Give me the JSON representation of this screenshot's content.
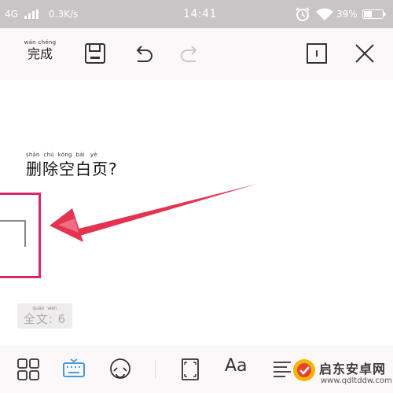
{
  "status_bar": {
    "network": "4G",
    "speed": "0.3K/s",
    "time": "14:41",
    "battery": "39%"
  },
  "toolbar": {
    "done_pinyin": "wán chéng",
    "done_label": "完成",
    "icons": [
      "save-icon",
      "undo-icon",
      "redo-icon",
      "cursor-box-icon",
      "close-icon"
    ]
  },
  "document": {
    "question_pinyin": "shān  chú  kōng  bái   yè",
    "question_text": "删除空白页?",
    "word_count_pinyin": "quán  wén",
    "word_count": "全文: 6"
  },
  "bottom_bar": {
    "icons": [
      "grid-icon",
      "keyboard-icon",
      "emoji-icon",
      "page-frame-icon",
      "font-icon",
      "align-icon"
    ],
    "font_label": "Aa"
  },
  "watermark": {
    "title": "启东安卓网",
    "url": "www.qdltddw.com"
  },
  "colors": {
    "status_bar": "#c9c4c6",
    "toolbar_bg": "#fcf7f9",
    "annotation": "#d9266e",
    "keyboard_accent": "#2f8fd8"
  }
}
